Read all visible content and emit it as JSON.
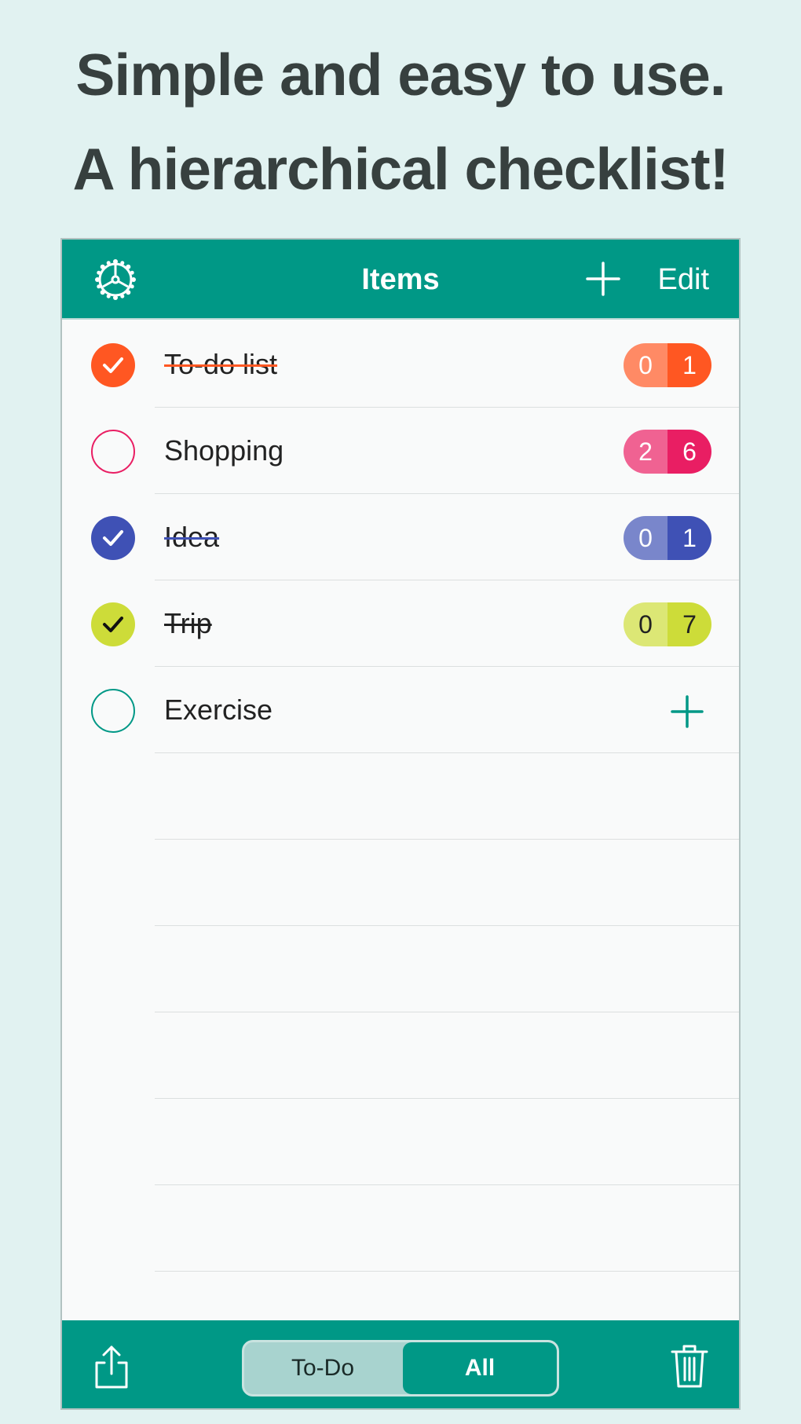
{
  "headline": {
    "line1": "Simple and easy to use.",
    "line2": "A hierarchical checklist!"
  },
  "navbar": {
    "title": "Items",
    "edit_label": "Edit",
    "left_icon": "gear-icon",
    "add_icon": "plus-icon"
  },
  "items": [
    {
      "label": "To-do list",
      "done": true,
      "color": "#ff5722",
      "light": "#ff8a65",
      "count_a": "0",
      "count_b": "1"
    },
    {
      "label": "Shopping",
      "done": false,
      "color": "#e91e63",
      "light": "#f06292",
      "count_a": "2",
      "count_b": "6"
    },
    {
      "label": "Idea",
      "done": true,
      "color": "#3f51b5",
      "light": "#7986cb",
      "count_a": "0",
      "count_b": "1"
    },
    {
      "label": "Trip",
      "done": true,
      "color": "#cddc39",
      "light": "#dce775",
      "count_a": "0",
      "count_b": "7"
    },
    {
      "label": "Exercise",
      "done": false,
      "color": "#009886",
      "light": "",
      "count_a": "",
      "count_b": ""
    }
  ],
  "toolbar": {
    "segment_todo": "To-Do",
    "segment_all": "All",
    "selected": "All",
    "share_icon": "share-icon",
    "trash_icon": "trash-icon"
  },
  "colors": {
    "accent": "#009886",
    "background": "#e1f2f1",
    "headline": "#37403f"
  }
}
